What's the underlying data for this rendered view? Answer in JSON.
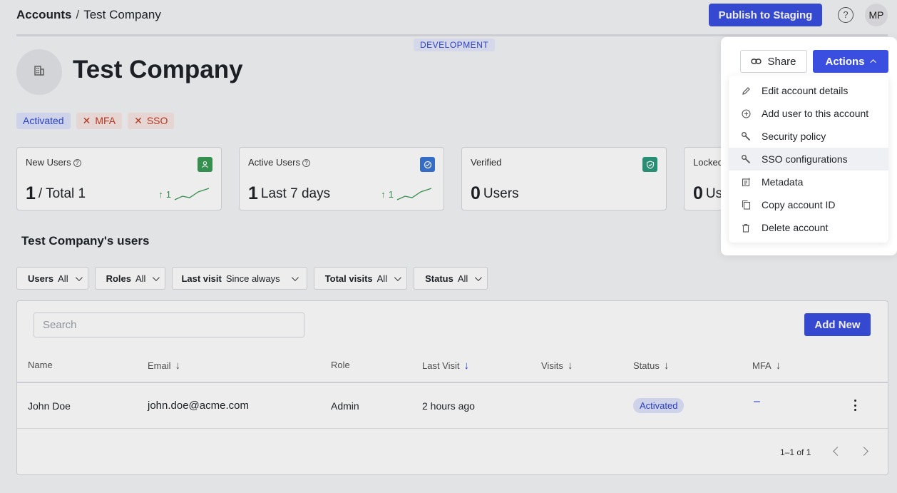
{
  "breadcrumb": {
    "root": "Accounts",
    "separator": "/",
    "current": "Test Company"
  },
  "header": {
    "publish_label": "Publish to Staging",
    "help_glyph": "?",
    "avatar_initials": "MP"
  },
  "environment_badge": "DEVELOPMENT",
  "company": {
    "name": "Test Company",
    "logo_icon": "building-icon"
  },
  "tags": [
    {
      "label": "Activated",
      "state": "on"
    },
    {
      "label": "MFA",
      "state": "off"
    },
    {
      "label": "SSO",
      "state": "off"
    }
  ],
  "stats": [
    {
      "label": "New Users",
      "help": true,
      "value": "1",
      "suffix": "/ Total 1",
      "trend": "1",
      "icon": "user-icon",
      "icon_color": "#3a9a55"
    },
    {
      "label": "Active Users",
      "help": true,
      "value": "1",
      "suffix": "Last 7 days",
      "trend": "1",
      "icon": "activity-icon",
      "icon_color": "#3a76d6"
    },
    {
      "label": "Verified",
      "help": false,
      "value": "0",
      "suffix": "Users",
      "icon": "shield-check-icon",
      "icon_color": "#2c9a7d"
    },
    {
      "label": "Locked",
      "help": false,
      "value": "0",
      "suffix": "Users"
    }
  ],
  "users_section": {
    "title": "Test Company's users"
  },
  "filters": [
    {
      "key": "Users",
      "value": "All"
    },
    {
      "key": "Roles",
      "value": "All"
    },
    {
      "key": "Last visit",
      "value": "Since always"
    },
    {
      "key": "Total visits",
      "value": "All"
    },
    {
      "key": "Status",
      "value": "All"
    }
  ],
  "table": {
    "search_placeholder": "Search",
    "add_new_label": "Add New",
    "columns": [
      "Name",
      "Email",
      "Role",
      "Last Visit",
      "Visits",
      "Status",
      "MFA"
    ],
    "rows": [
      {
        "name": "John Doe",
        "email": "john.doe@acme.com",
        "role": "Admin",
        "last_visit": "2 hours ago",
        "visits": "",
        "status": "Activated",
        "mfa": "–"
      }
    ],
    "pagination": "1–1 of 1"
  },
  "popover": {
    "share_label": "Share",
    "actions_label": "Actions",
    "menu": [
      {
        "label": "Edit account details",
        "icon": "pencil-icon"
      },
      {
        "label": "Add user to this account",
        "icon": "plus-circle-icon"
      },
      {
        "label": "Security policy",
        "icon": "wrench-icon"
      },
      {
        "label": "SSO configurations",
        "icon": "wrench-icon",
        "hovered": true
      },
      {
        "label": "Metadata",
        "icon": "metadata-icon"
      },
      {
        "label": "Copy account ID",
        "icon": "copy-icon"
      },
      {
        "label": "Delete account",
        "icon": "trash-icon"
      }
    ]
  }
}
